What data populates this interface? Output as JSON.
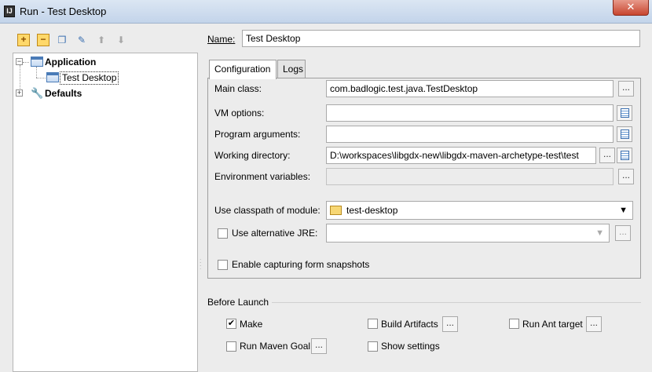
{
  "window": {
    "title": "Run - Test Desktop",
    "close_glyph": "✕",
    "app_icon_letter": "IJ"
  },
  "toolbar": {
    "buttons": [
      {
        "name": "add-icon",
        "glyph": "+"
      },
      {
        "name": "remove-icon",
        "glyph": "−"
      },
      {
        "name": "copy-icon",
        "glyph": "❐"
      },
      {
        "name": "wrench-icon",
        "glyph": "✎"
      },
      {
        "name": "move-up-icon",
        "glyph": "⬆"
      },
      {
        "name": "move-down-icon",
        "glyph": "⬇"
      }
    ]
  },
  "tree": {
    "application": "Application",
    "test_desktop": "Test Desktop",
    "defaults": "Defaults",
    "expander_minus": "−",
    "expander_plus": "+"
  },
  "name_row": {
    "label": "Name:",
    "value": "Test Desktop"
  },
  "tabs": [
    {
      "label": "Configuration"
    },
    {
      "label": "Logs"
    }
  ],
  "config": {
    "main_class": {
      "label": "Main class:",
      "value": "com.badlogic.test.java.TestDesktop"
    },
    "vm_options": {
      "label": "VM options:",
      "value": ""
    },
    "program_arguments": {
      "label": "Program arguments:",
      "value": ""
    },
    "working_directory": {
      "label": "Working directory:",
      "value": "D:\\workspaces\\libgdx-new\\libgdx-maven-archetype-test\\test"
    },
    "environment_variables": {
      "label": "Environment variables:",
      "value": ""
    },
    "classpath_module": {
      "label": "Use classpath of module:",
      "value": "test-desktop",
      "arrow": "▼"
    },
    "alternative_jre": {
      "label": "Use alternative JRE:",
      "value": "",
      "checked": false,
      "arrow": "▼"
    },
    "form_snapshots": {
      "label": "Enable capturing form snapshots",
      "checked": false
    },
    "dots": "..."
  },
  "before_launch": {
    "title": "Before Launch",
    "items": [
      {
        "label": "Make",
        "checked": true,
        "mark": "✔"
      },
      {
        "label": "Build Artifacts",
        "checked": false,
        "mark": ""
      },
      {
        "label": "Run Ant target",
        "checked": false,
        "mark": ""
      },
      {
        "label": "Run Maven Goal",
        "checked": false,
        "mark": ""
      },
      {
        "label": "Show settings",
        "checked": false,
        "mark": ""
      }
    ]
  }
}
